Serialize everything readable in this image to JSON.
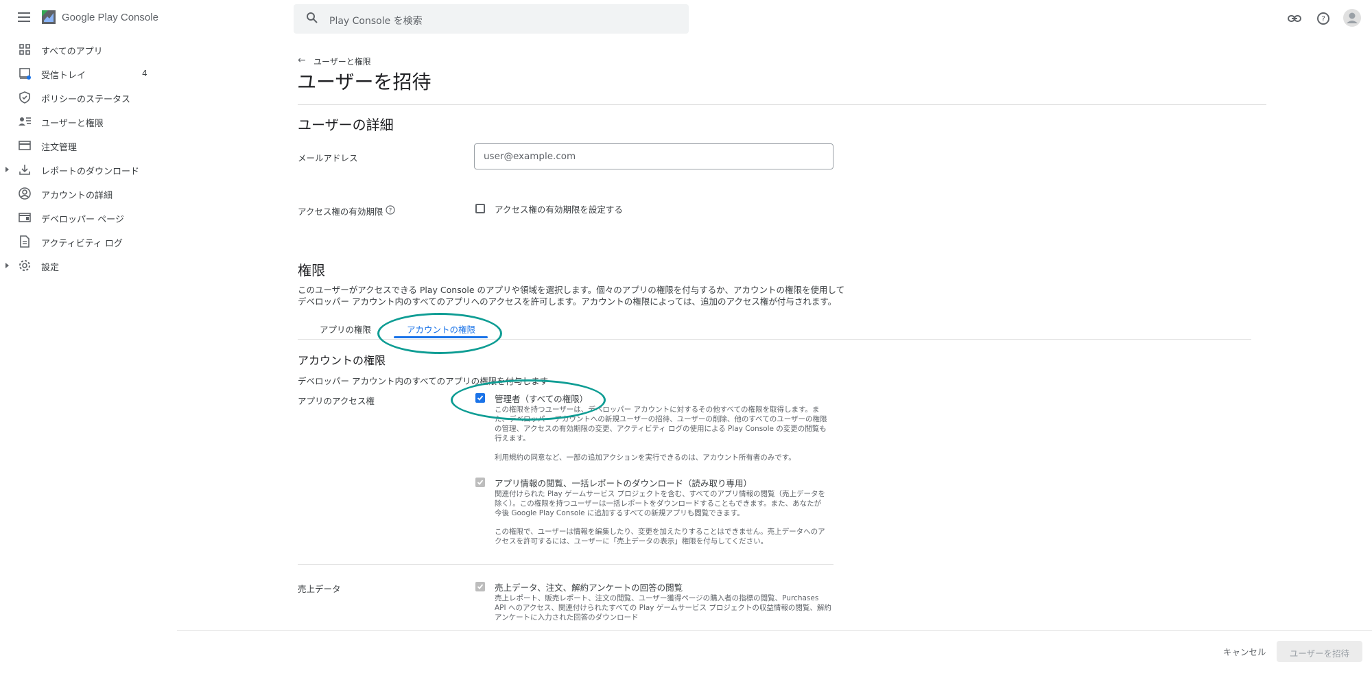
{
  "app": {
    "name": "Google Play Console"
  },
  "search": {
    "placeholder": "Play Console を検索"
  },
  "sidebar": {
    "items": [
      {
        "label": "すべてのアプリ"
      },
      {
        "label": "受信トレイ",
        "badge": "4"
      },
      {
        "label": "ポリシーのステータス"
      },
      {
        "label": "ユーザーと権限"
      },
      {
        "label": "注文管理"
      },
      {
        "label": "レポートのダウンロード"
      },
      {
        "label": "アカウントの詳細"
      },
      {
        "label": "デベロッパー ページ"
      },
      {
        "label": "アクティビティ ログ"
      },
      {
        "label": "設定"
      }
    ]
  },
  "page": {
    "breadcrumb": "ユーザーと権限",
    "title": "ユーザーを招待"
  },
  "details": {
    "heading": "ユーザーの詳細",
    "email_label": "メールアドレス",
    "email_placeholder": "user@example.com",
    "expiry_label": "アクセス権の有効期限",
    "expiry_checkbox": "アクセス権の有効期限を設定する"
  },
  "permissions": {
    "heading": "権限",
    "desc_line1": "このユーザーがアクセスできる Play Console のアプリや領域を選択します。個々のアプリの権限を付与するか、アカウントの権限を使用して",
    "desc_line2": "デベロッパー アカウント内のすべてのアプリへのアクセスを許可します。アカウントの権限によっては、追加のアクセス権が付与されます。",
    "tabs": [
      {
        "label": "アプリの権限",
        "active": false
      },
      {
        "label": "アカウントの権限",
        "active": true
      }
    ],
    "account_heading": "アカウントの権限",
    "account_sub": "デベロッパー アカウント内のすべてのアプリの権限を付与します",
    "app_access_label": "アプリのアクセス権",
    "admin": {
      "title": "管理者（すべての権限）",
      "checked": true,
      "lines": [
        "この権限を持つユーザーは、デベロッパー アカウントに対するその他すべての権限を取得します。ま",
        "た、デベロッパー アカウントへの新規ユーザーの招待、ユーザーの削除、他のすべてのユーザーの権限",
        "の管理、アクセスの有効期限の変更、アクティビティ ログの使用による Play Console の変更の閲覧も",
        "行えます。"
      ],
      "note": "利用規約の同意など、一部の追加アクションを実行できるのは、アカウント所有者のみです。"
    },
    "view_info": {
      "title": "アプリ情報の閲覧、一括レポートのダウンロード（読み取り専用）",
      "lines": [
        "関連付けられた Play ゲームサービス プロジェクトを含む、すべてのアプリ情報の閲覧（売上データを",
        "除く）。この権限を持つユーザーは一括レポートをダウンロードすることもできます。また、あなたが",
        "今後 Google Play Console に追加するすべての新規アプリも閲覧できます。"
      ],
      "note_lines": [
        "この権限で、ユーザーは情報を編集したり、変更を加えたりすることはできません。売上データへのア",
        "クセスを許可するには、ユーザーに「売上データの表示」権限を付与してください。"
      ]
    },
    "sales_label": "売上データ",
    "sales": {
      "title": "売上データ、注文、解約アンケートの回答の閲覧",
      "lines": [
        "売上レポート、販売レポート、注文の閲覧、ユーザー獲得ページの購入者の指標の閲覧、Purchases",
        "API へのアクセス、関連付けられたすべての Play ゲームサービス プロジェクトの収益情報の閲覧、解約",
        "アンケートに入力された回答のダウンロード"
      ]
    }
  },
  "footer": {
    "cancel": "キャンセル",
    "invite": "ユーザーを招待"
  },
  "colors": {
    "accent": "#1a73e8",
    "annotation": "#0f9d94"
  }
}
